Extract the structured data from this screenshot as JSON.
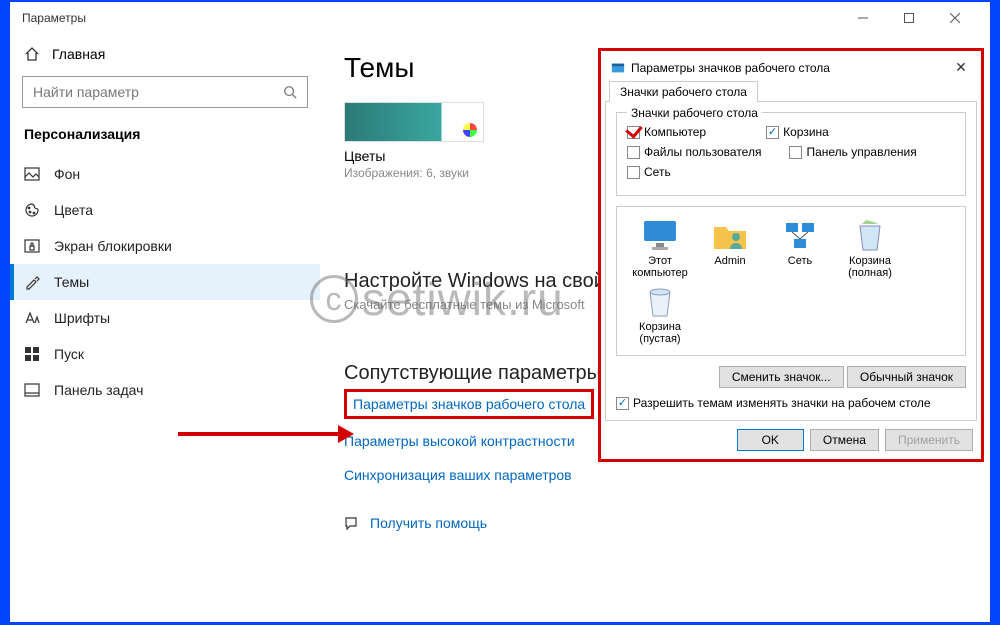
{
  "window": {
    "title": "Параметры"
  },
  "home_label": "Главная",
  "search_placeholder": "Найти параметр",
  "section": "Персонализация",
  "nav": [
    {
      "label": "Фон"
    },
    {
      "label": "Цвета"
    },
    {
      "label": "Экран блокировки"
    },
    {
      "label": "Темы"
    },
    {
      "label": "Шрифты"
    },
    {
      "label": "Пуск"
    },
    {
      "label": "Панель задач"
    }
  ],
  "main": {
    "title": "Темы",
    "theme_name": "Цветы",
    "theme_sub": "Изображения: 6, звуки",
    "customize_h": "Настройте Windows на свой",
    "customize_sub": "Скачайте бесплатные темы из Microsoft",
    "related_h": "Сопутствующие параметры",
    "links": [
      "Параметры значков рабочего стола",
      "Параметры высокой контрастности",
      "Синхронизация ваших параметров"
    ],
    "help": "Получить помощь"
  },
  "dialog": {
    "title": "Параметры значков рабочего стола",
    "tab": "Значки рабочего стола",
    "group": "Значки рабочего стола",
    "checks": {
      "computer": "Компьютер",
      "recycle": "Корзина",
      "userfiles": "Файлы пользователя",
      "cpanel": "Панель управления",
      "network": "Сеть"
    },
    "icons": [
      "Этот компьютер",
      "Admin",
      "Сеть",
      "Корзина (полная)",
      "Корзина (пустая)"
    ],
    "change_btn": "Сменить значок...",
    "default_btn": "Обычный значок",
    "allow_themes": "Разрешить темам изменять значки на рабочем столе",
    "ok": "OK",
    "cancel": "Отмена",
    "apply": "Применить"
  },
  "watermark": "setiwik.ru"
}
